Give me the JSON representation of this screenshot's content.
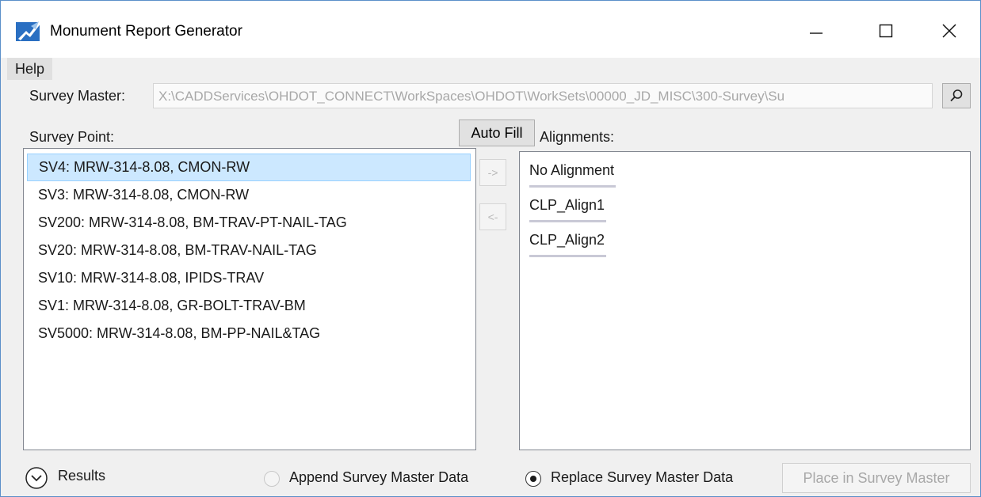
{
  "window": {
    "title": "Monument Report Generator",
    "app_icon": "monument-app-icon"
  },
  "menu": {
    "help_label": "Help"
  },
  "survey_master": {
    "label": "Survey Master:",
    "path_value": "X:\\CADDServices\\OHDOT_CONNECT\\WorkSpaces\\OHDOT\\WorkSets\\00000_JD_MISC\\300-Survey\\Su",
    "browse_icon": "search-icon"
  },
  "survey_point": {
    "label": "Survey Point:",
    "items": [
      "SV4: MRW-314-8.08, CMON-RW",
      "SV3: MRW-314-8.08, CMON-RW",
      "SV200: MRW-314-8.08, BM-TRAV-PT-NAIL-TAG",
      "SV20: MRW-314-8.08, BM-TRAV-NAIL-TAG",
      "SV10: MRW-314-8.08, IPIDS-TRAV",
      "SV1: MRW-314-8.08, GR-BOLT-TRAV-BM",
      "SV5000: MRW-314-8.08, BM-PP-NAIL&TAG"
    ],
    "selected_index": 0
  },
  "auto_fill_label": "Auto Fill",
  "move_buttons": {
    "right_label": "->",
    "left_label": "<-"
  },
  "alignments": {
    "label": "Alignments:",
    "items": [
      "No Alignment",
      "CLP_Align1",
      "CLP_Align2"
    ]
  },
  "footer": {
    "results_label": "Results",
    "append_label": "Append Survey Master Data",
    "replace_label": "Replace Survey Master Data",
    "selected_option": "replace",
    "place_button_label": "Place in Survey Master"
  },
  "colors": {
    "selection_bg": "#cce8ff",
    "selection_border": "#99d1ff",
    "window_border": "#5b8fc9",
    "app_icon_blue": "#2a6fc2"
  }
}
